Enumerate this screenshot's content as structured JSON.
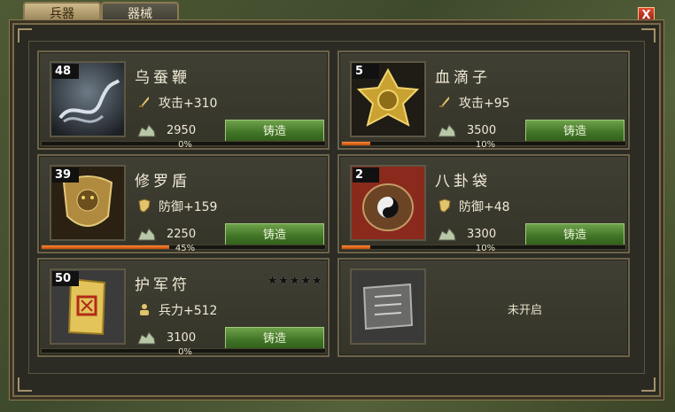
{
  "tabs": [
    {
      "label": "兵器"
    },
    {
      "label": "器械"
    }
  ],
  "close_label": "X",
  "forge_label": "铸造",
  "cards": [
    {
      "level": "48",
      "name": "乌蚕鞭",
      "stat": "攻击+310",
      "stat_icon": "sword-icon",
      "cost": "2950",
      "progress": 0,
      "progress_label": "0%"
    },
    {
      "level": "5",
      "name": "血滴子",
      "stat": "攻击+95",
      "stat_icon": "sword-icon",
      "cost": "3500",
      "progress": 10,
      "progress_label": "10%"
    },
    {
      "level": "39",
      "name": "修罗盾",
      "stat": "防御+159",
      "stat_icon": "shield-icon",
      "cost": "2250",
      "progress": 45,
      "progress_label": "45%"
    },
    {
      "level": "2",
      "name": "八卦袋",
      "stat": "防御+48",
      "stat_icon": "shield-icon",
      "cost": "3300",
      "progress": 10,
      "progress_label": "10%"
    },
    {
      "level": "50",
      "name": "护军符",
      "stars": "★★★★★",
      "stat": "兵力+512",
      "stat_icon": "troops-icon",
      "cost": "3100",
      "progress": 0,
      "progress_label": "0%"
    }
  ],
  "locked_card": {
    "label": "未开启"
  }
}
